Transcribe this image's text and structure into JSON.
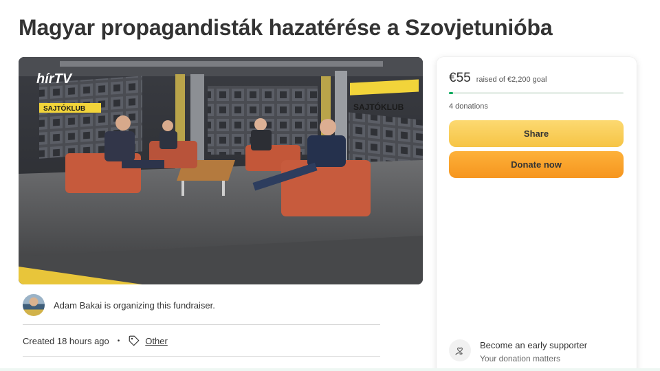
{
  "page": {
    "title": "Magyar propagandisták hazatérése a Szovjetunióba"
  },
  "hero": {
    "channel_logo": "hírTV",
    "show_name": "SAJTÓKLUB",
    "show_name_right": "SAJTÓKLUB"
  },
  "organizer": {
    "text": "Adam Bakai is organizing this fundraiser."
  },
  "meta": {
    "created": "Created 18 hours ago",
    "separator": "•",
    "category": "Other",
    "category_icon": "tag-icon"
  },
  "donation": {
    "amount": "€55",
    "goal_text": "raised of €2,200 goal",
    "progress_fraction": 0.025,
    "count_text": "4 donations",
    "share_label": "Share",
    "donate_label": "Donate now",
    "supporter_icon": "hand-heart-icon",
    "supporter_title": "Become an early supporter",
    "supporter_sub": "Your donation matters"
  },
  "colors": {
    "progress": "#02a95c",
    "share_button": "#f6c445",
    "donate_button": "#f6951e"
  }
}
